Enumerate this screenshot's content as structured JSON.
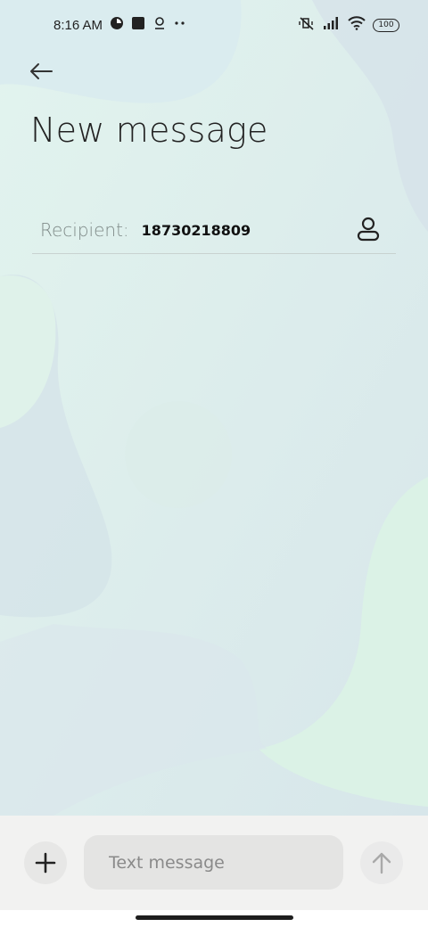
{
  "status_bar": {
    "time": "8:16 AM",
    "left_icons": [
      "vpn-icon",
      "square-app-icon",
      "location-icon",
      "more-dots-icon"
    ],
    "right_icons": [
      "mute-vibrate-icon",
      "signal-icon",
      "wifi-icon"
    ],
    "battery": "100"
  },
  "header": {
    "title": "New message"
  },
  "recipient": {
    "label": "Recipient:",
    "value": "18730218809"
  },
  "compose": {
    "placeholder": "Text message"
  },
  "colors": {
    "background": "#e6f2f0",
    "compose_bar": "#f2f2f1",
    "input_bg": "#e4e4e3"
  }
}
